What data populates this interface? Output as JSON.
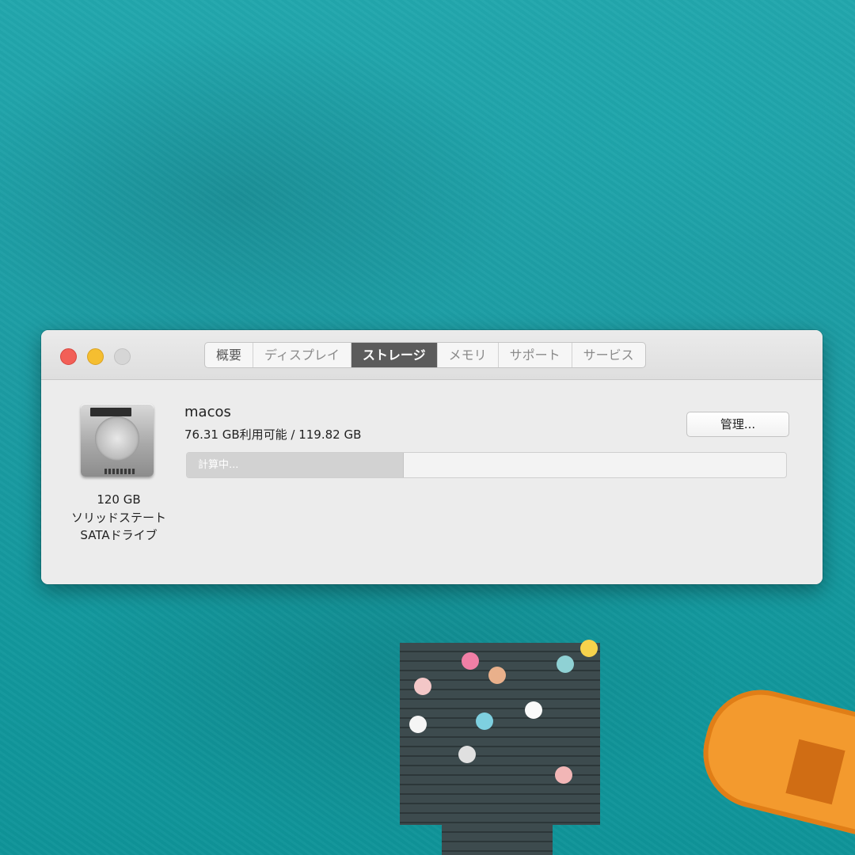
{
  "window": {
    "tabs": [
      {
        "label": "概要",
        "active": false
      },
      {
        "label": "ディスプレイ",
        "active": false
      },
      {
        "label": "ストレージ",
        "active": true
      },
      {
        "label": "メモリ",
        "active": false
      },
      {
        "label": "サポート",
        "active": false
      },
      {
        "label": "サービス",
        "active": false
      }
    ]
  },
  "drive": {
    "icon": "hard-drive-icon",
    "capacity": "120 GB",
    "type": "ソリッドステート",
    "interface": "SATAドライブ"
  },
  "volume": {
    "name": "macos",
    "availability": "76.31 GB利用可能 / 119.82 GB",
    "manage_button": "管理...",
    "usage_bar_text": "計算中...",
    "used_fraction": 0.36
  },
  "colors": {
    "close": "#f25f57",
    "minimize": "#f5be30",
    "zoom_disabled": "#d6d6d6",
    "active_tab": "#5b5b5b",
    "desktop_water": "#1c9ca3"
  }
}
